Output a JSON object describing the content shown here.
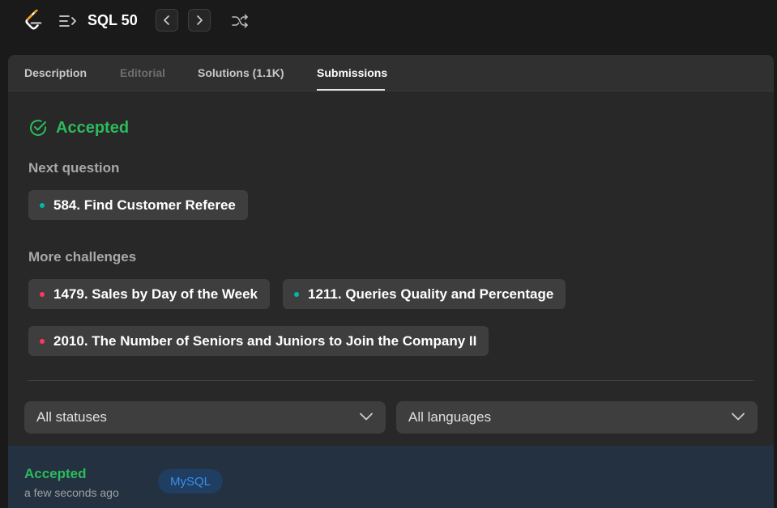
{
  "topbar": {
    "list_title": "SQL 50",
    "icons": {
      "logo": "leetcode-logo",
      "list": "problem-list-icon",
      "prev": "chevron-left-icon",
      "next": "chevron-right-icon",
      "shuffle": "shuffle-icon"
    }
  },
  "tabs": [
    {
      "label": "Description",
      "state": "normal"
    },
    {
      "label": "Editorial",
      "state": "disabled"
    },
    {
      "label": "Solutions (1.1K)",
      "state": "normal"
    },
    {
      "label": "Submissions",
      "state": "active"
    }
  ],
  "result": {
    "status": "Accepted",
    "status_color": "#2cbb5d",
    "icon": "check-circle-icon"
  },
  "next_question": {
    "label": "Next question",
    "items": [
      {
        "title": "584. Find Customer Referee",
        "difficulty_color": "#00b8a3"
      }
    ]
  },
  "more_challenges": {
    "label": "More challenges",
    "items": [
      {
        "title": "1479. Sales by Day of the Week",
        "difficulty_color": "#ff375f"
      },
      {
        "title": "1211. Queries Quality and Percentage",
        "difficulty_color": "#00b8a3"
      },
      {
        "title": "2010. The Number of Seniors and Juniors to Join the Company II",
        "difficulty_color": "#ff375f"
      }
    ]
  },
  "filters": {
    "status": {
      "value": "All statuses"
    },
    "language": {
      "value": "All languages"
    }
  },
  "submissions": [
    {
      "status": "Accepted",
      "time": "a few seconds ago",
      "language": "MySQL"
    }
  ]
}
